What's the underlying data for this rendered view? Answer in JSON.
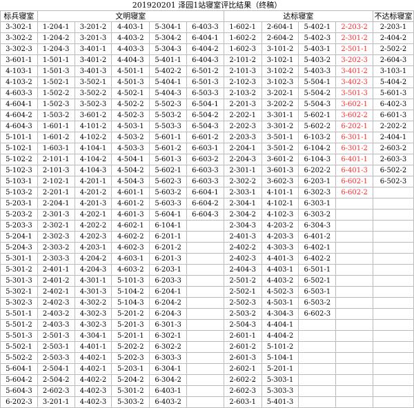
{
  "title": "201920201 泽园1站寝室评比结果（终稿）",
  "headers": {
    "model": "标兵寝室",
    "civil": "文明寝室",
    "standard": "达标寝室",
    "fail": "不达标寝室"
  },
  "rows": [
    [
      "3-302-1",
      "1-204-1",
      "3-201-2",
      "4-403-1",
      "5-304-1",
      "6-403-3",
      "1-602-1",
      "2-604-1",
      "5-402-1",
      "2-203-2",
      "2-203-1"
    ],
    [
      "3-302-2",
      "1-204-2",
      "3-201-3",
      "4-403-2",
      "5-304-2",
      "6-404-1",
      "1-602-2",
      "2-604-2",
      "5-402-3",
      "2-301-2",
      "2-404-2"
    ],
    [
      "3-302-3",
      "1-204-3",
      "3-401-1",
      "4-403-3",
      "5-304-3",
      "6-404-2",
      "1-602-3",
      "3-101-2",
      "5-403-1",
      "2-501-1",
      "2-502-2"
    ],
    [
      "3-601-1",
      "1-501-1",
      "3-401-2",
      "4-404-3",
      "5-401-1",
      "6-404-3",
      "2-101-2",
      "3-102-1",
      "5-403-2",
      "3-202-3",
      "2-604-3"
    ],
    [
      "4-103-1",
      "1-501-3",
      "3-401-3",
      "4-501-1",
      "5-402-2",
      "6-501-2",
      "2-101-3",
      "3-102-2",
      "5-403-3",
      "3-401-2",
      "3-103-1"
    ],
    [
      "4-103-2",
      "1-502-1",
      "3-502-1",
      "4-501-3",
      "5-404-1",
      "6-501-3",
      "2-102-3",
      "3-102-3",
      "5-504-1",
      "3-402-3",
      "5-404-2"
    ],
    [
      "4-603-3",
      "1-502-2",
      "3-502-2",
      "4-502-1",
      "5-404-3",
      "6-503-3",
      "2-103-2",
      "3-202-1",
      "5-504-2",
      "3-501-3",
      "5-601-3"
    ],
    [
      "4-604-1",
      "1-502-3",
      "3-502-3",
      "4-502-2",
      "5-502-3",
      "6-504-1",
      "2-201-3",
      "3-202-2",
      "5-504-3",
      "3-602-1",
      "6-402-3"
    ],
    [
      "4-604-2",
      "1-503-2",
      "3-601-2",
      "4-502-3",
      "5-503-2",
      "6-504-2",
      "2-202-1",
      "3-301-1",
      "5-602-1",
      "3-602-2",
      "6-601-3"
    ],
    [
      "4-604-3",
      "1-601-1",
      "4-101-2",
      "4-503-1",
      "5-503-3",
      "6-504-3",
      "2-202-3",
      "3-301-2",
      "5-602-2",
      "6-202-1",
      "2-202-2"
    ],
    [
      "5-101-1",
      "1-601-2",
      "4-102-2",
      "4-503-2",
      "5-601-1",
      "6-601-2",
      "2-203-3",
      "3-501-1",
      "6-103-2",
      "6-301-1",
      "2-404-1"
    ],
    [
      "5-102-1",
      "1-603-1",
      "4-104-1",
      "4-503-3",
      "5-601-2",
      "6-603-1",
      "2-204-1",
      "3-501-2",
      "6-104-2",
      "6-301-2",
      "2-603-2"
    ],
    [
      "5-102-2",
      "2-101-1",
      "4-104-2",
      "4-504-1",
      "5-601-3",
      "6-603-2",
      "2-204-3",
      "3-601-2",
      "6-104-3",
      "6-401-1",
      "2-603-3"
    ],
    [
      "5-102-3",
      "2-101-3",
      "4-104-3",
      "4-504-2",
      "5-602-1",
      "6-603-3",
      "2-301-1",
      "3-601-3",
      "6-202-2",
      "6-401-3",
      "6-502-2"
    ],
    [
      "5-103-1",
      "2-102-1",
      "4-201-1",
      "4-504-3",
      "5-602-3",
      "6-603-3",
      "2-302-2",
      "3-602-3",
      "6-203-1",
      "6-602-1",
      "6-502-3"
    ],
    [
      "5-103-2",
      "2-201-1",
      "4-201-2",
      "4-601-1",
      "5-603-2",
      "6-604-1",
      "2-303-1",
      "4-101-1",
      "6-302-3",
      "6-602-2",
      ""
    ],
    [
      "5-203-1",
      "2-204-1",
      "4-201-3",
      "4-601-2",
      "5-603-3",
      "6-604-2",
      "2-304-1",
      "4-102-1",
      "6-303-1",
      "",
      ""
    ],
    [
      "5-203-2",
      "2-301-3",
      "4-202-1",
      "4-601-3",
      "5-604-1",
      "6-604-3",
      "2-304-2",
      "4-102-3",
      "6-303-2",
      "",
      ""
    ],
    [
      "5-203-3",
      "2-302-1",
      "4-202-2",
      "4-602-1",
      "6-104-1",
      "",
      "2-304-3",
      "4-203-2",
      "6-304-3",
      "",
      ""
    ],
    [
      "5-204-1",
      "2-302-3",
      "4-202-3",
      "4-602-2",
      "6-201-1",
      "",
      "2-401-3",
      "4-203-3",
      "6-401-2",
      "",
      ""
    ],
    [
      "5-204-3",
      "2-303-2",
      "4-203-1",
      "4-602-3",
      "6-201-2",
      "",
      "2-402-2",
      "4-303-3",
      "6-402-1",
      "",
      ""
    ],
    [
      "5-301-1",
      "2-303-3",
      "4-204-2",
      "4-603-1",
      "6-201-3",
      "",
      "2-402-3",
      "4-401-3",
      "6-402-2",
      "",
      ""
    ],
    [
      "5-301-2",
      "2-401-1",
      "4-204-3",
      "4-603-2",
      "6-203-1",
      "",
      "2-404-3",
      "4-403-1",
      "6-501-1",
      "",
      ""
    ],
    [
      "5-301-3",
      "2-401-2",
      "4-301-1",
      "5-101-3",
      "6-203-3",
      "",
      "2-501-2",
      "4-403-2",
      "6-502-1",
      "",
      ""
    ],
    [
      "5-302-1",
      "2-402-1",
      "4-301-3",
      "5-104-2",
      "6-204-1",
      "",
      "2-502-1",
      "4-502-3",
      "6-503-1",
      "",
      ""
    ],
    [
      "5-302-3",
      "2-402-3",
      "4-302-2",
      "5-104-3",
      "6-204-2",
      "",
      "2-502-3",
      "4-503-1",
      "6-503-2",
      "",
      ""
    ],
    [
      "5-501-1",
      "2-403-2",
      "4-302-3",
      "5-201-2",
      "6-204-3",
      "",
      "2-503-2",
      "4-304-3",
      "6-602-3",
      "",
      ""
    ],
    [
      "5-501-2",
      "2-403-3",
      "4-302-3",
      "5-201-3",
      "6-301-3",
      "",
      "2-504-3",
      "4-404-1",
      "",
      "",
      ""
    ],
    [
      "5-501-3",
      "2-501-3",
      "4-304-1",
      "5-201-1",
      "6-302-1",
      "",
      "2-601-1",
      "4-404-2",
      "",
      "",
      ""
    ],
    [
      "5-502-1",
      "2-503-1",
      "4-401-1",
      "5-202-2",
      "6-302-2",
      "",
      "2-601-2",
      "5-101-2",
      "",
      "",
      ""
    ],
    [
      "5-502-2",
      "2-503-3",
      "4-402-1",
      "5-202-3",
      "6-303-3",
      "",
      "2-601-3",
      "5-104-1",
      "",
      "",
      ""
    ],
    [
      "5-604-1",
      "2-504-1",
      "4-402-1",
      "5-203-1",
      "6-304-1",
      "",
      "2-602-1",
      "5-201-1",
      "",
      "",
      ""
    ],
    [
      "5-604-2",
      "2-504-2",
      "4-402-2",
      "5-204-2",
      "6-304-2",
      "",
      "2-602-2",
      "5-303-1",
      "",
      "",
      ""
    ],
    [
      "5-604-3",
      "2-602-3",
      "4-402-3",
      "5-301-2",
      "6-403-1",
      "",
      "2-602-3",
      "5-303-3",
      "",
      "",
      ""
    ],
    [
      "6-202-3",
      "3-201-1",
      "4-402-3",
      "5-303-2",
      "6-403-2",
      "",
      "2-603-1",
      "5-401-3",
      "",
      "",
      ""
    ]
  ],
  "colors": {
    "grid": "#b9b9b9",
    "text": "#000000",
    "highlight": "#ff2a2a"
  },
  "red_columns": [
    9
  ]
}
